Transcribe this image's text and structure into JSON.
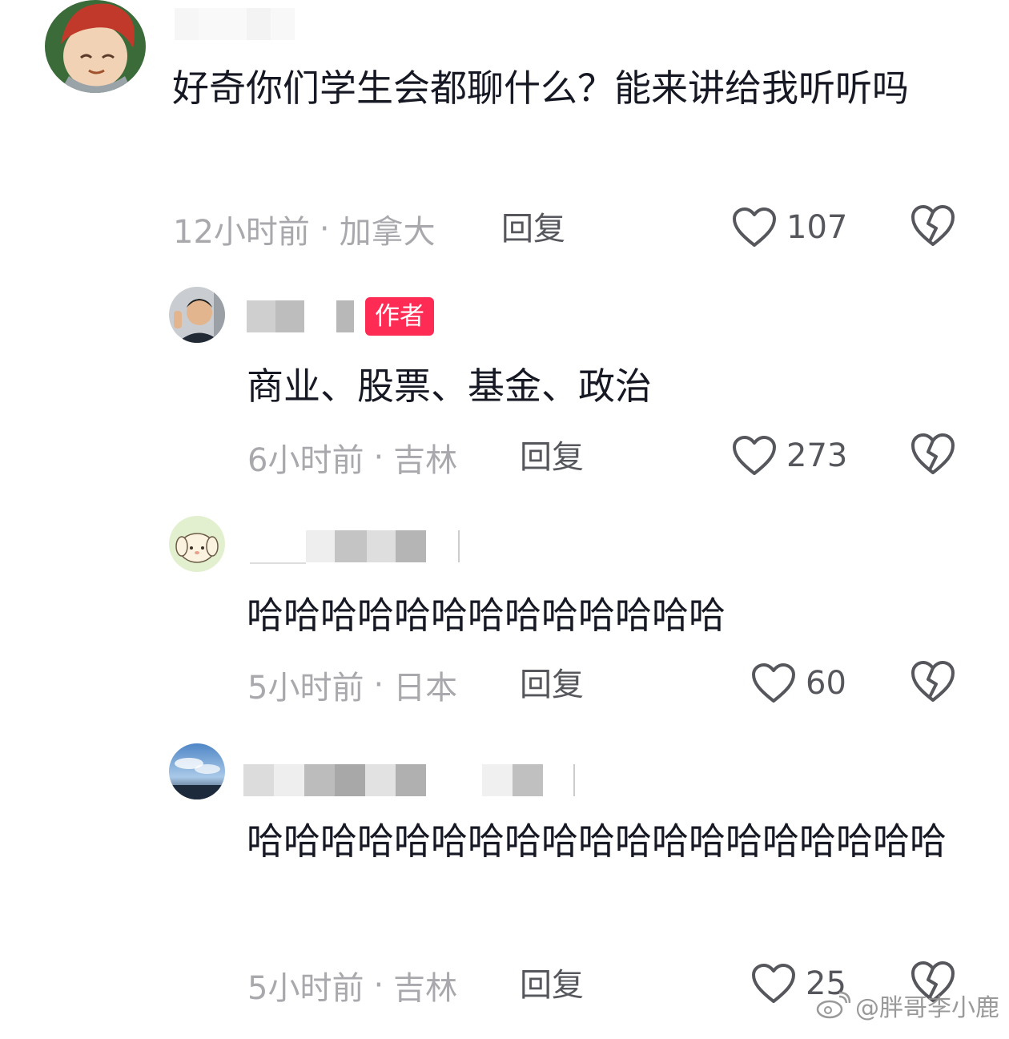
{
  "comments": [
    {
      "text": "好奇你们学生会都聊什么？能来讲给我听听吗",
      "time": "12小时前",
      "location": "加拿大",
      "reply_label": "回复",
      "likes": "107"
    },
    {
      "author_tag": "作者",
      "text": "商业、股票、基金、政治",
      "time": "6小时前",
      "location": "吉林",
      "reply_label": "回复",
      "likes": "273"
    },
    {
      "text": "哈哈哈哈哈哈哈哈哈哈哈哈哈",
      "time": "5小时前",
      "location": "日本",
      "reply_label": "回复",
      "likes": "60"
    },
    {
      "text": "哈哈哈哈哈哈哈哈哈哈哈哈哈哈哈哈哈哈哈",
      "time": "5小时前",
      "location": "吉林",
      "reply_label": "回复",
      "likes": "25"
    }
  ],
  "separator": "·",
  "watermark": "@胖哥李小鹿",
  "colors": {
    "author_tag_bg": "#fe2c55",
    "meta_text": "#a9a9ad",
    "action_text": "#56575c"
  },
  "icons": [
    "heart-outline-icon",
    "broken-heart-icon",
    "weibo-logo-icon"
  ]
}
